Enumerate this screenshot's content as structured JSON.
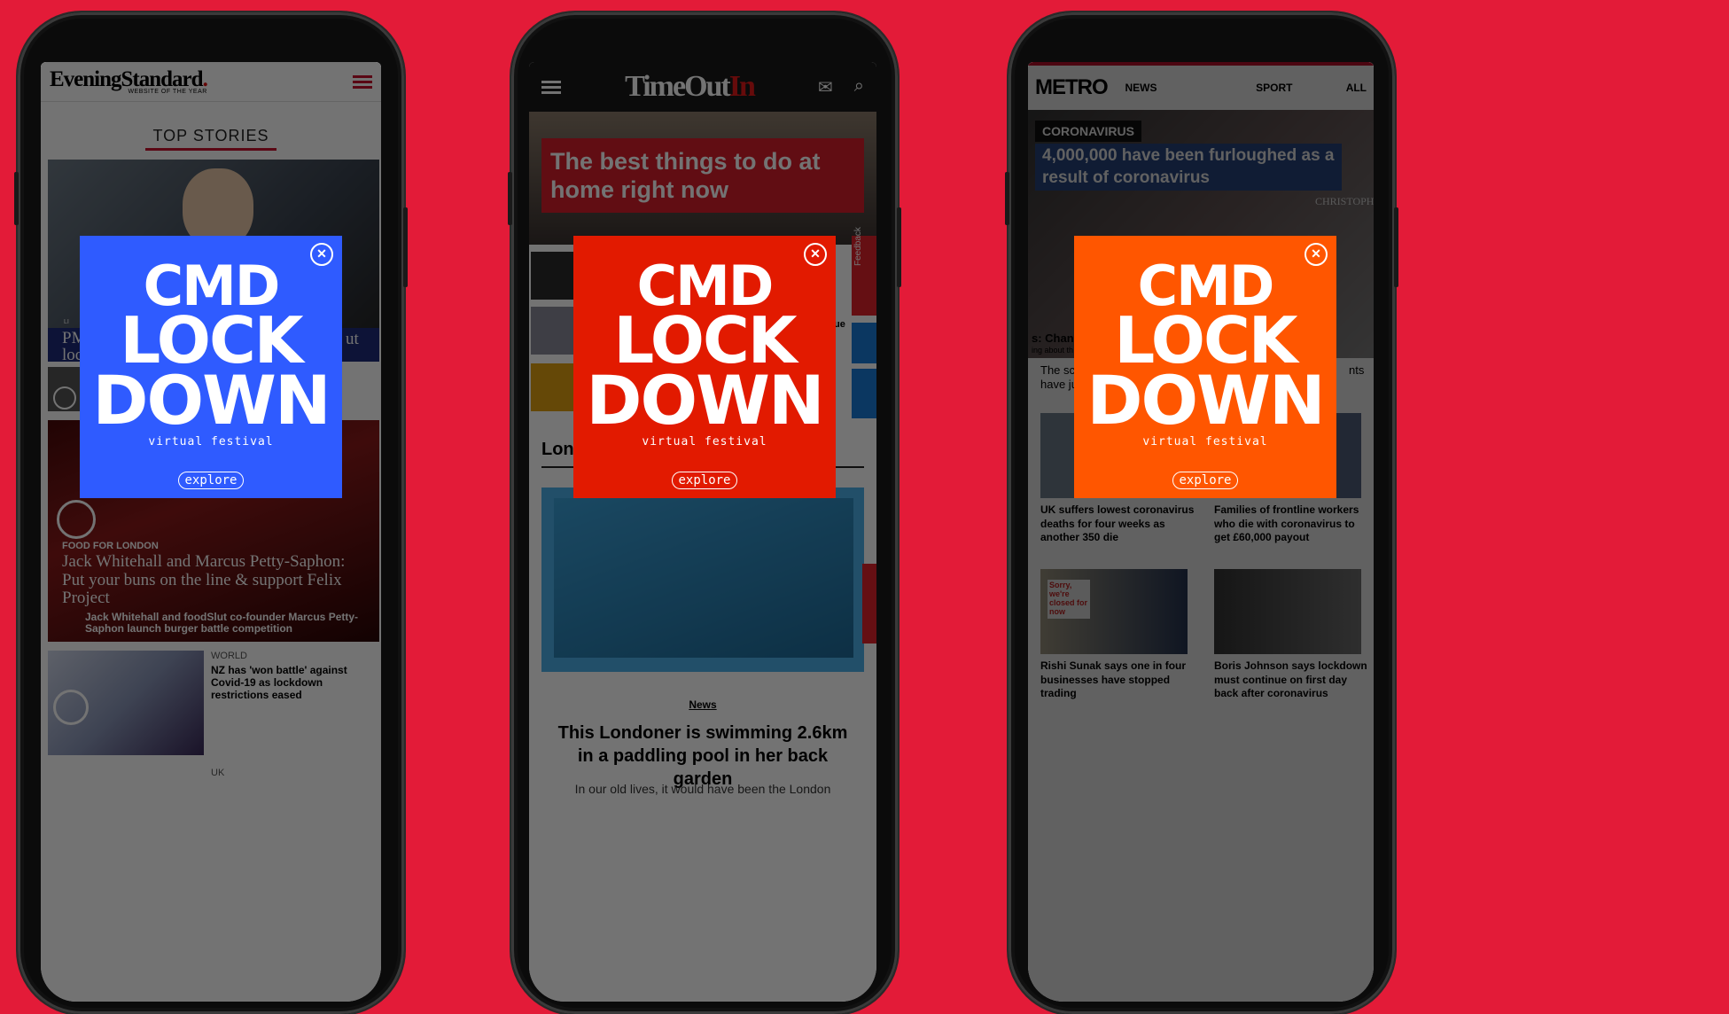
{
  "colors": {
    "background": "#e31b38",
    "popup_blue": "#2f5bff",
    "popup_red": "#e21a00",
    "popup_orange": "#ff5600"
  },
  "popup": {
    "line1": "CMD",
    "line2": "LOCK",
    "line3": "DOWN",
    "subtitle": "virtual festival",
    "cta": "explore",
    "close_icon": "close-circle-icon"
  },
  "phone1": {
    "logo": "EveningStandard",
    "logo_dot": ".",
    "tagline": "WEBSITE OF THE YEAR",
    "section_title": "TOP STORIES",
    "menu_icon": "hamburger-menu-icon",
    "story1_partial": "PM",
    "story1_partial2": "loc",
    "story1_right_partial": "ut",
    "live_label": "LI",
    "story2_category": "FOOD FOR LONDON",
    "story2_headline": "Jack Whitehall and Marcus Petty-Saphon: Put your buns on the line & support Felix Project",
    "story2_sub": "Jack Whitehall and foodSlut co-founder Marcus Petty-Saphon launch burger battle competition",
    "story3_category": "WORLD",
    "story3_headline": "NZ has 'won battle' against Covid-19 as lockdown restrictions eased",
    "story4_category": "UK"
  },
  "phone2": {
    "logo_a": "TimeOut",
    "logo_b": "In",
    "menu_icon": "hamburger-menu-icon",
    "mail_icon": "mail-icon",
    "search_icon": "search-icon",
    "hero_headline": "The best things to do at home right now",
    "feedback_label": "Feedback",
    "partial_ue": "ue",
    "section_partial": "Lon",
    "tag": "News",
    "article_headline": "This Londoner is swimming 2.6km in a paddling pool in her back garden",
    "article_body_partial": "In our old lives, it would have been the London"
  },
  "phone3": {
    "logo": "METRO",
    "nav": [
      "NEWS",
      "SPORT",
      "ALL"
    ],
    "tag": "CORONAVIRUS",
    "hero_headline": "4,000,000 have been furloughed as a result of coronavirus",
    "shop_sign": "CHRISTOPH",
    "left_partial1": "s: Chanc",
    "left_partial2": "ing about th",
    "left_partial3": "The sc",
    "left_partial4": "have ju",
    "right_partial": "nts",
    "card1": "UK suffers lowest coronavirus deaths for four weeks as another 350 die",
    "card2": "Families of frontline workers who die with coronavirus to get £60,000 payout",
    "card3": "Rishi Sunak says one in four businesses have stopped trading",
    "card4": "Boris Johnson says lockdown must continue on first day back after coronavirus",
    "sign_text": "Sorry, we're closed for now"
  }
}
